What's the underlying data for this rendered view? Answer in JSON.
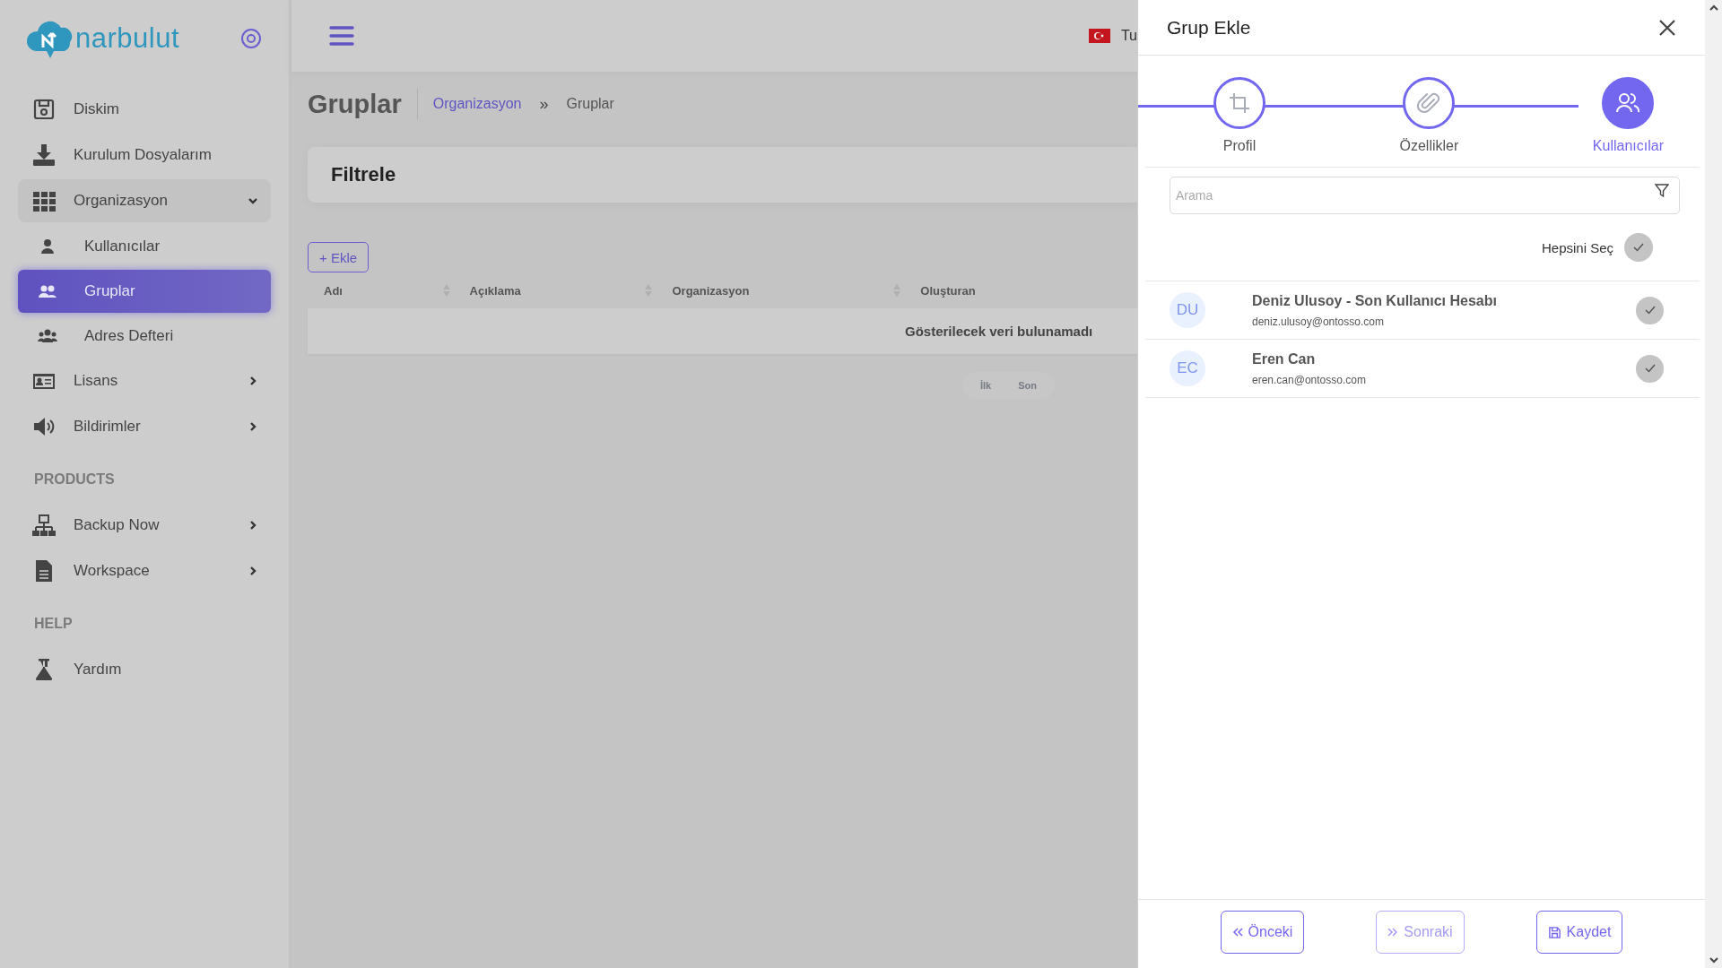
{
  "sidebar": {
    "logo": "narbulut",
    "items": [
      {
        "kind": "item",
        "label": "Diskim",
        "selected": false
      },
      {
        "kind": "item",
        "label": "Kurulum Dosyalarım",
        "selected": false
      },
      {
        "kind": "item",
        "label": "Organizasyon",
        "selected": false,
        "expanded": true,
        "children": [
          {
            "label": "Kullanıcılar",
            "selected": false
          },
          {
            "label": "Gruplar",
            "selected": true
          },
          {
            "label": "Adres Defteri",
            "selected": false
          }
        ]
      },
      {
        "kind": "item",
        "label": "Lisans",
        "selected": false,
        "expanded": false
      },
      {
        "kind": "item",
        "label": "Bildirimler",
        "selected": false,
        "expanded": false
      },
      {
        "kind": "section",
        "label": "PRODUCTS"
      },
      {
        "kind": "item",
        "label": "Backup Now",
        "selected": false,
        "expanded": false
      },
      {
        "kind": "item",
        "label": "Workspace",
        "selected": false,
        "expanded": false
      },
      {
        "kind": "section",
        "label": "HELP"
      },
      {
        "kind": "item",
        "label": "Yardım",
        "selected": false
      }
    ]
  },
  "header": {
    "language": "Tu"
  },
  "page": {
    "title": "Gruplar",
    "breadcrumb": [
      "Organizasyon",
      "Gruplar"
    ],
    "breadcrumb_separator": "»",
    "filter_title": "Filtrele",
    "add_button": "+ Ekle",
    "table": {
      "columns": [
        "Adı",
        "Açıklama",
        "Organizasyon",
        "Oluşturan"
      ],
      "empty_text": "Gösterilecek veri bulunamadı"
    },
    "pagination": [
      "İlk",
      "Son"
    ]
  },
  "drawer": {
    "title": "Grup Ekle",
    "steps": [
      {
        "label": "Profil",
        "selected": false
      },
      {
        "label": "Özellikler",
        "selected": false
      },
      {
        "label": "Kullanıcılar",
        "selected": true
      }
    ],
    "search": {
      "placeholder": "Arama"
    },
    "select_all": {
      "label": "Hepsini Seç",
      "checked": false
    },
    "users": [
      {
        "initials": "DU",
        "name": "Deniz Ulusoy - Son Kullanıcı Hesabı",
        "email": "deniz.ulusoy@ontosso.com",
        "checked": false
      },
      {
        "initials": "EC",
        "name": "Eren Can",
        "email": "eren.can@ontosso.com",
        "checked": false
      }
    ],
    "buttons": [
      {
        "kind": "prev",
        "label": "Önceki",
        "disabled": false
      },
      {
        "kind": "next",
        "label": "Sonraki",
        "disabled": true
      },
      {
        "kind": "save",
        "label": "Kaydet",
        "disabled": false
      }
    ]
  }
}
